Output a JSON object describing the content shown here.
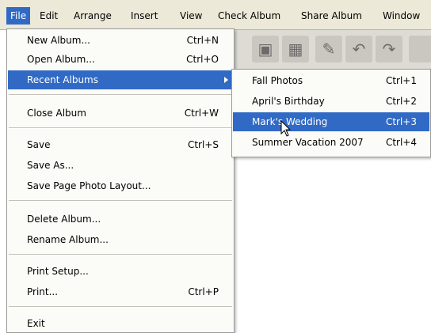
{
  "menubar": {
    "items": [
      "File",
      "Edit",
      "Arrange",
      "Insert",
      "View",
      "Check Album",
      "Share Album",
      "Window"
    ]
  },
  "file_menu": {
    "new_album": {
      "label": "New Album...",
      "shortcut": "Ctrl+N"
    },
    "open_album": {
      "label": "Open Album...",
      "shortcut": "Ctrl+O"
    },
    "recent_albums": {
      "label": "Recent Albums"
    },
    "close_album": {
      "label": "Close Album",
      "shortcut": "Ctrl+W"
    },
    "save": {
      "label": "Save",
      "shortcut": "Ctrl+S"
    },
    "save_as": {
      "label": "Save As..."
    },
    "save_page_layout": {
      "label": "Save Page Photo Layout..."
    },
    "delete_album": {
      "label": "Delete Album..."
    },
    "rename_album": {
      "label": "Rename Album..."
    },
    "print_setup": {
      "label": "Print Setup..."
    },
    "print": {
      "label": "Print...",
      "shortcut": "Ctrl+P"
    },
    "exit": {
      "label": "Exit"
    }
  },
  "recent_menu": {
    "items": [
      {
        "label": "Fall Photos",
        "shortcut": "Ctrl+1"
      },
      {
        "label": "April's Birthday",
        "shortcut": "Ctrl+2"
      },
      {
        "label": "Mark's Wedding",
        "shortcut": "Ctrl+3"
      },
      {
        "label": "Summer Vacation 2007",
        "shortcut": "Ctrl+4"
      }
    ],
    "highlighted_index": 2
  },
  "colors": {
    "highlight": "#316ac5",
    "menubar": "#ece9d8",
    "menu_bg": "#fbfbf7"
  },
  "toolbar": {
    "icons": [
      "photo-icon",
      "frame-icon",
      "edit-icon",
      "undo-icon",
      "redo-icon"
    ]
  }
}
